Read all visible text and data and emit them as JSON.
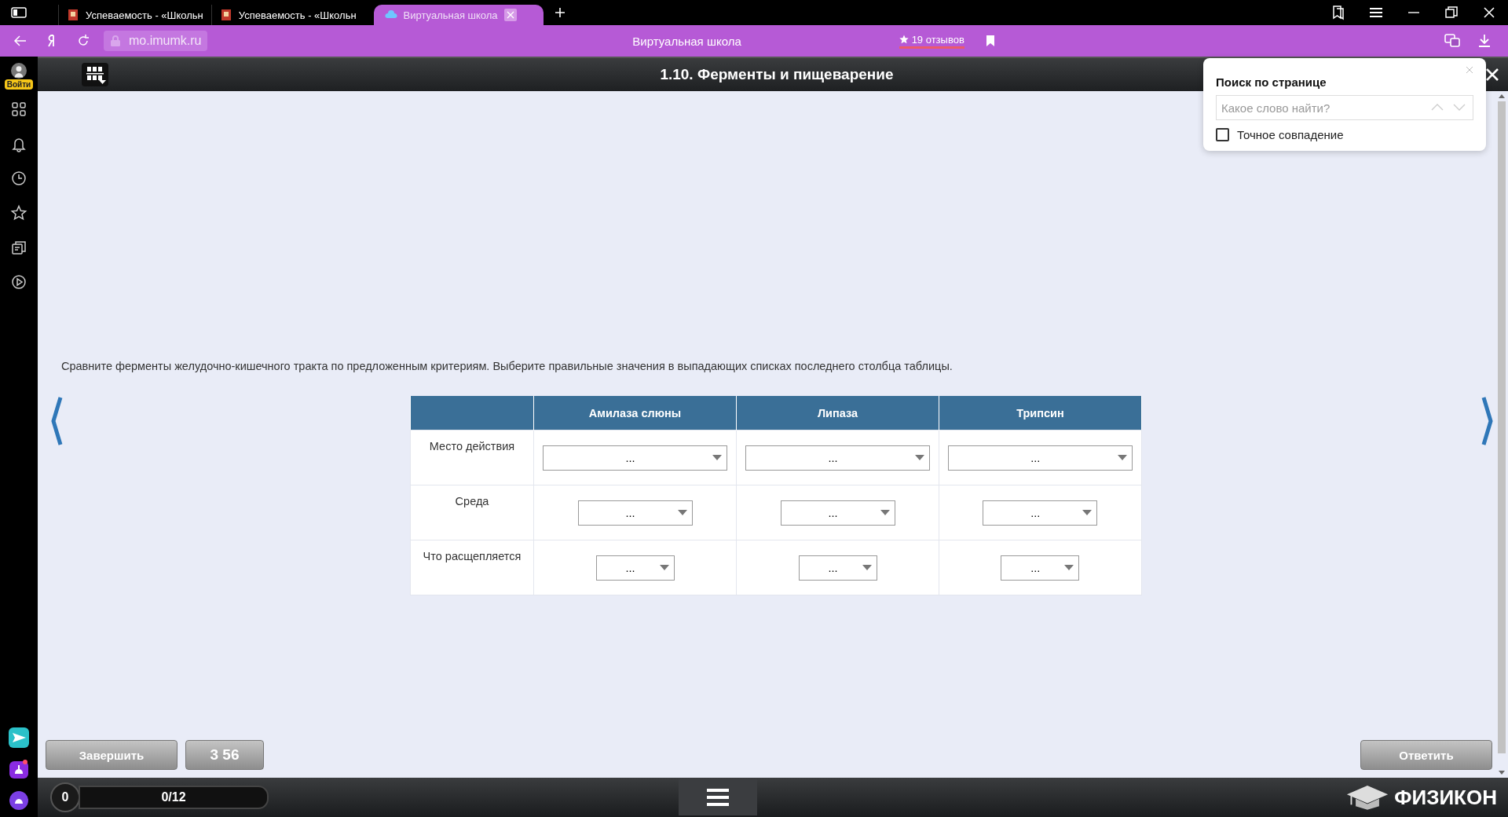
{
  "browser": {
    "tabs": [
      {
        "title": "Успеваемость - «Школьн",
        "selected": false,
        "kind": "journal"
      },
      {
        "title": "Успеваемость - «Школьн",
        "selected": false,
        "kind": "journal"
      },
      {
        "title": "Виртуальная школа",
        "selected": true,
        "kind": "cloud"
      }
    ],
    "address": "mo.imumk.ru",
    "page_title": "Виртуальная школа",
    "reviews": "19 отзывов"
  },
  "sidebar": {
    "login": "Войти"
  },
  "lesson": {
    "title": "1.10. Ферменты и пищеварение",
    "instruction": "Сравните ферменты желудочно-кишечного тракта по предложенным критериям. Выберите правильные значения в выпадающих списках последнего столбца таблицы.",
    "table": {
      "columns": [
        "Амилаза слюны",
        "Липаза",
        "Трипсин"
      ],
      "rows": [
        {
          "label": "Место действия",
          "cells": [
            "...",
            "...",
            "..."
          ]
        },
        {
          "label": "Среда",
          "cells": [
            "...",
            "...",
            "..."
          ]
        },
        {
          "label": "Что расщепляется",
          "cells": [
            "...",
            "...",
            "..."
          ]
        }
      ]
    },
    "buttons": {
      "finish": "Завершить",
      "timer": "3 56",
      "answer": "Ответить"
    }
  },
  "footer": {
    "score": "0",
    "progress": {
      "text": "0/12",
      "level": 0
    },
    "logo": "ФИЗИКОН"
  },
  "find": {
    "title": "Поиск по странице",
    "placeholder": "Какое слово найти?",
    "exact_match": {
      "label": "Точное совпадение",
      "checked": false
    }
  }
}
